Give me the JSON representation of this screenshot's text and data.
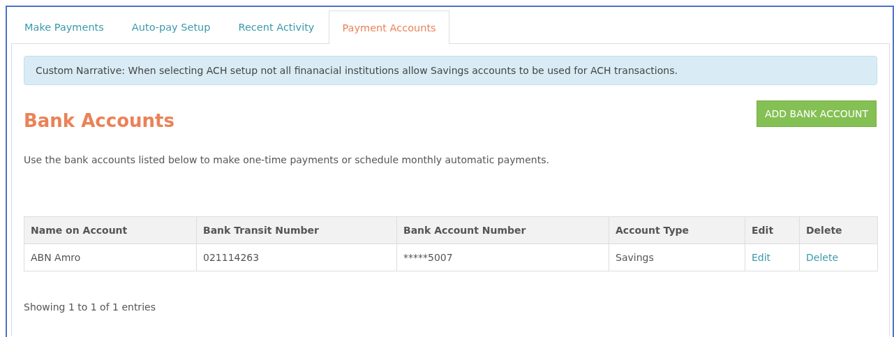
{
  "tabs": [
    {
      "label": "Make Payments",
      "selected": false
    },
    {
      "label": "Auto-pay Setup",
      "selected": false
    },
    {
      "label": "Recent Activity",
      "selected": false
    },
    {
      "label": "Payment Accounts",
      "selected": true
    }
  ],
  "notice": "Custom Narrative: When selecting ACH setup not all finanacial institutions allow Savings accounts to be used for ACH transactions.",
  "heading": "Bank Accounts",
  "add_button": "ADD BANK ACCOUNT",
  "description": "Use the bank accounts listed below to make one-time payments or schedule monthly automatic payments.",
  "table": {
    "columns": [
      "Name on Account",
      "Bank Transit Number",
      "Bank Account Number",
      "Account Type",
      "Edit",
      "Delete"
    ],
    "rows": [
      [
        {
          "text": "ABN Amro",
          "kind": "text"
        },
        {
          "text": "021114263",
          "kind": "text"
        },
        {
          "text": "*****5007",
          "kind": "text"
        },
        {
          "text": "Savings",
          "kind": "text"
        },
        {
          "text": "Edit",
          "kind": "link"
        },
        {
          "text": "Delete",
          "kind": "link"
        }
      ]
    ]
  },
  "footer": "Showing 1 to 1 of 1 entries"
}
